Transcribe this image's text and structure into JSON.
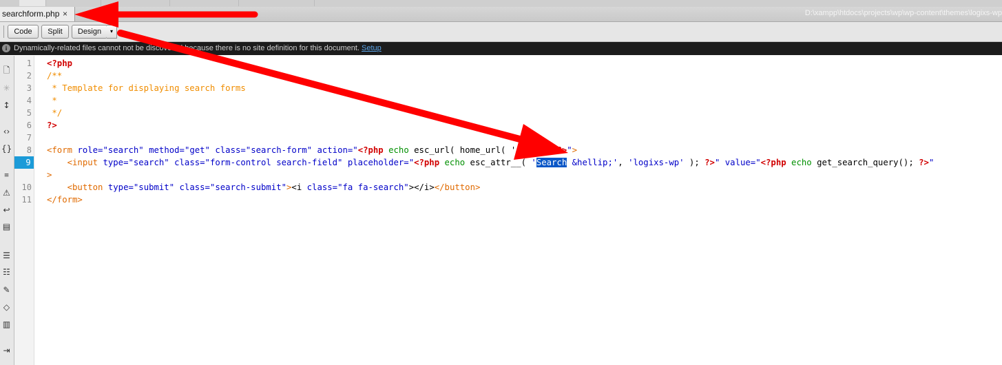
{
  "tab": {
    "filename": "searchform.php",
    "close_glyph": "×"
  },
  "path": "D:\\xampp\\htdocs\\projects\\wp\\wp-content\\themes\\logixs-wp",
  "toolbar": {
    "code": "Code",
    "split": "Split",
    "design": "Design",
    "dropdown_glyph": "▾"
  },
  "infobar": {
    "message": "Dynamically-related files cannot not be discovered because there is no site definition for this document.",
    "link": "Setup"
  },
  "editor": {
    "line_numbers": [
      "1",
      "2",
      "3",
      "4",
      "5",
      "6",
      "7",
      "8",
      "9",
      "",
      "10",
      "11"
    ],
    "current_line": "9"
  },
  "sidebar_icons": [
    "open-documents-icon",
    "collapse-icon",
    "expand-icon",
    "select-parent-tag-icon",
    "balance-braces-icon",
    "line-numbers-icon",
    "highlight-invalid-code-icon",
    "word-wrap-icon",
    "syntax-coloring-icon",
    "apply-comment-icon",
    "remove-comment-icon",
    "wrap-tag-icon",
    "recent-snippets-icon",
    "move-css-icon",
    "indent-code-icon"
  ],
  "colors": {
    "php_delim": "#d10000",
    "comment": "#f08d00",
    "tag": "#0000c8",
    "current_line": "#1c9bd8",
    "annotation_arrow": "#ff0000"
  }
}
